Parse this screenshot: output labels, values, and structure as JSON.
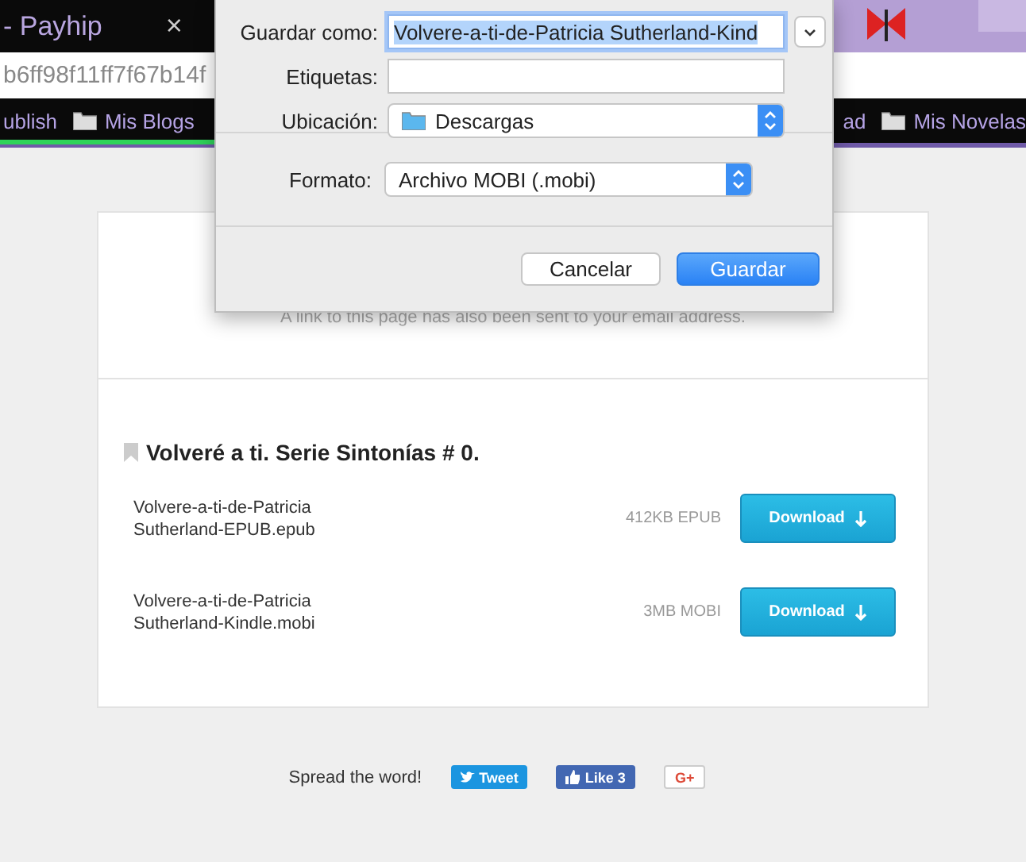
{
  "browser": {
    "tab": {
      "title": "- Payhip",
      "close": "×"
    },
    "address": "b6ff98f11ff7f67b14f",
    "bookmarks_left": [
      {
        "label": "ublish",
        "folder": false
      },
      {
        "label": "Mis Blogs",
        "folder": true
      }
    ],
    "bookmarks_right": [
      {
        "label": "ad",
        "folder": false
      },
      {
        "label": "Mis Novelas",
        "folder": true
      }
    ]
  },
  "save_dialog": {
    "save_as_label": "Guardar como:",
    "save_as_value": "Volvere-a-ti-de-Patricia Sutherland-Kind",
    "tags_label": "Etiquetas:",
    "location_label": "Ubicación:",
    "location_value": "Descargas",
    "format_label": "Formato:",
    "format_value": "Archivo MOBI (.mobi)",
    "buttons": [
      {
        "label": "Cancelar",
        "kind": "secondary"
      },
      {
        "label": "Guardar",
        "kind": "primary"
      }
    ]
  },
  "page": {
    "notice": "A link to this page has also been sent to your email address.",
    "product_title": "Volveré a ti. Serie Sintonías # 0.",
    "files": [
      {
        "name": "Volvere-a-ti-de-Patricia Sutherland-EPUB.epub",
        "size": "412KB EPUB",
        "button": "Download"
      },
      {
        "name": "Volvere-a-ti-de-Patricia Sutherland-Kindle.mobi",
        "size": "3MB MOBI",
        "button": "Download"
      }
    ],
    "share": {
      "label": "Spread the word!",
      "tweet": "Tweet",
      "like": "Like 3",
      "gplus": "G+"
    }
  }
}
